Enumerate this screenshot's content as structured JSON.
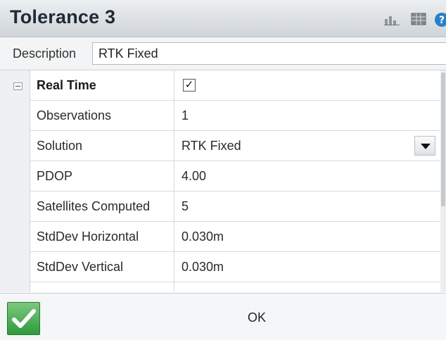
{
  "window": {
    "title": "Tolerance 3",
    "icons": [
      "chart-icon",
      "grid-icon",
      "help-icon"
    ]
  },
  "description": {
    "label": "Description",
    "value": "RTK Fixed"
  },
  "group": {
    "name": "Real Time",
    "checked": true,
    "check_glyph": "✓"
  },
  "rows": [
    {
      "name": "Observations",
      "value": "1"
    },
    {
      "name": "Solution",
      "value": "RTK Fixed"
    },
    {
      "name": "PDOP",
      "value": "4.00"
    },
    {
      "name": "Satellites Computed",
      "value": "5"
    },
    {
      "name": "StdDev Horizontal",
      "value": "0.030m"
    },
    {
      "name": "StdDev Vertical",
      "value": "0.030m"
    }
  ],
  "footer": {
    "ok_label": "OK"
  },
  "colors": {
    "title_text": "#1f2a36",
    "accept_green": "#2f9a3c",
    "grid_line": "#d7dadd"
  }
}
